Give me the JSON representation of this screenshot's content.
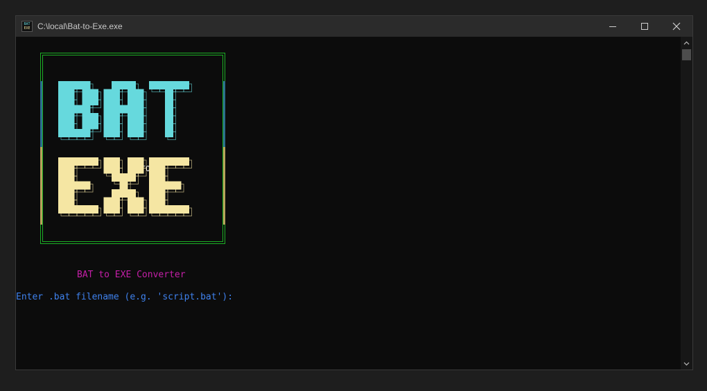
{
  "window": {
    "title": "C:\\local\\Bat-to-Exe.exe",
    "icon_name": "bat-exe-app-icon",
    "icon_text_top": "BAT",
    "icon_text_bottom": "EXE"
  },
  "controls": {
    "minimize_icon": "minimize-icon",
    "maximize_icon": "maximize-icon",
    "close_icon": "close-icon"
  },
  "logo": {
    "word_top": "BAT",
    "word_mid": "TO",
    "word_bottom": "EXE",
    "top_color": "#66d9dd",
    "bottom_color": "#f5e6a3",
    "frame_color": "#1cb025"
  },
  "console": {
    "converter_title": "BAT to EXE Converter",
    "prompt": "Enter .bat filename (e.g. 'script.bat'):",
    "title_color": "#c51fa8",
    "prompt_color": "#3f82ee",
    "background": "#0c0c0c"
  }
}
